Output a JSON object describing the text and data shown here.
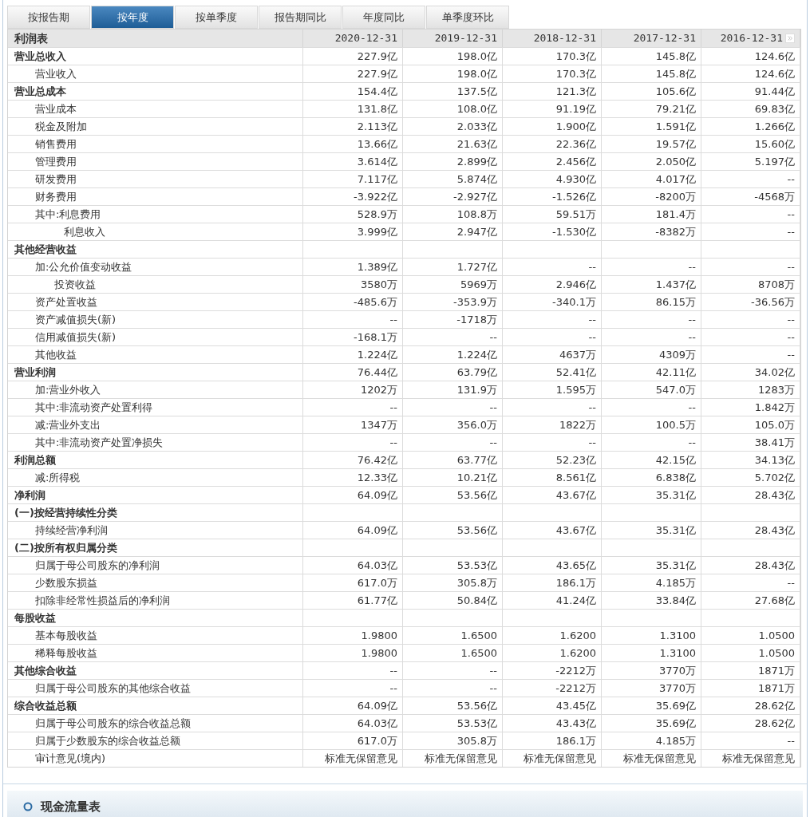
{
  "tabs": [
    {
      "label": "按报告期",
      "selected": false
    },
    {
      "label": "按年度",
      "selected": true
    },
    {
      "label": "按单季度",
      "selected": false
    },
    {
      "label": "报告期同比",
      "selected": false
    },
    {
      "label": "年度同比",
      "selected": false
    },
    {
      "label": "单季度环比",
      "selected": false
    }
  ],
  "table": {
    "title": "利润表",
    "columns": [
      "2020-12-31",
      "2019-12-31",
      "2018-12-31",
      "2017-12-31",
      "2016-12-31"
    ],
    "rows": [
      {
        "label": "营业总收入",
        "kind": "heading",
        "values": [
          "227.9亿",
          "198.0亿",
          "170.3亿",
          "145.8亿",
          "124.6亿"
        ]
      },
      {
        "label": "营业收入",
        "kind": "item",
        "values": [
          "227.9亿",
          "198.0亿",
          "170.3亿",
          "145.8亿",
          "124.6亿"
        ]
      },
      {
        "label": "营业总成本",
        "kind": "heading",
        "values": [
          "154.4亿",
          "137.5亿",
          "121.3亿",
          "105.6亿",
          "91.44亿"
        ]
      },
      {
        "label": "营业成本",
        "kind": "item",
        "values": [
          "131.8亿",
          "108.0亿",
          "91.19亿",
          "79.21亿",
          "69.83亿"
        ]
      },
      {
        "label": "税金及附加",
        "kind": "item",
        "values": [
          "2.113亿",
          "2.033亿",
          "1.900亿",
          "1.591亿",
          "1.266亿"
        ]
      },
      {
        "label": "销售费用",
        "kind": "item",
        "values": [
          "13.66亿",
          "21.63亿",
          "22.36亿",
          "19.57亿",
          "15.60亿"
        ]
      },
      {
        "label": "管理费用",
        "kind": "item",
        "values": [
          "3.614亿",
          "2.899亿",
          "2.456亿",
          "2.050亿",
          "5.197亿"
        ]
      },
      {
        "label": "研发费用",
        "kind": "item",
        "values": [
          "7.117亿",
          "5.874亿",
          "4.930亿",
          "4.017亿",
          "--"
        ]
      },
      {
        "label": "财务费用",
        "kind": "item",
        "values": [
          "-3.922亿",
          "-2.927亿",
          "-1.526亿",
          "-8200万",
          "-4568万"
        ]
      },
      {
        "label": "其中:利息费用",
        "kind": "item",
        "values": [
          "528.9万",
          "108.8万",
          "59.51万",
          "181.4万",
          "--"
        ]
      },
      {
        "label": "利息收入",
        "kind": "sub2",
        "values": [
          "3.999亿",
          "2.947亿",
          "-1.530亿",
          "-8382万",
          "--"
        ]
      },
      {
        "label": "其他经营收益",
        "kind": "heading"
      },
      {
        "label": "加:公允价值变动收益",
        "kind": "item",
        "values": [
          "1.389亿",
          "1.727亿",
          "--",
          "--",
          "--"
        ]
      },
      {
        "label": "投资收益",
        "kind": "sub",
        "values": [
          "3580万",
          "5969万",
          "2.946亿",
          "1.437亿",
          "8708万"
        ]
      },
      {
        "label": "资产处置收益",
        "kind": "item",
        "values": [
          "-485.6万",
          "-353.9万",
          "-340.1万",
          "86.15万",
          "-36.56万"
        ]
      },
      {
        "label": "资产减值损失(新)",
        "kind": "item",
        "values": [
          "--",
          "-1718万",
          "--",
          "--",
          "--"
        ]
      },
      {
        "label": "信用减值损失(新)",
        "kind": "item",
        "values": [
          "-168.1万",
          "--",
          "--",
          "--",
          "--"
        ]
      },
      {
        "label": "其他收益",
        "kind": "item",
        "values": [
          "1.224亿",
          "1.224亿",
          "4637万",
          "4309万",
          "--"
        ]
      },
      {
        "label": "营业利润",
        "kind": "heading",
        "values": [
          "76.44亿",
          "63.79亿",
          "52.41亿",
          "42.11亿",
          "34.02亿"
        ]
      },
      {
        "label": "加:营业外收入",
        "kind": "item",
        "values": [
          "1202万",
          "131.9万",
          "1.595万",
          "547.0万",
          "1283万"
        ]
      },
      {
        "label": "其中:非流动资产处置利得",
        "kind": "item",
        "values": [
          "--",
          "--",
          "--",
          "--",
          "1.842万"
        ]
      },
      {
        "label": "减:营业外支出",
        "kind": "item",
        "values": [
          "1347万",
          "356.0万",
          "1822万",
          "100.5万",
          "105.0万"
        ]
      },
      {
        "label": "其中:非流动资产处置净损失",
        "kind": "item",
        "values": [
          "--",
          "--",
          "--",
          "--",
          "38.41万"
        ]
      },
      {
        "label": "利润总额",
        "kind": "heading",
        "values": [
          "76.42亿",
          "63.77亿",
          "52.23亿",
          "42.15亿",
          "34.13亿"
        ]
      },
      {
        "label": "减:所得税",
        "kind": "item",
        "values": [
          "12.33亿",
          "10.21亿",
          "8.561亿",
          "6.838亿",
          "5.702亿"
        ]
      },
      {
        "label": "净利润",
        "kind": "heading",
        "values": [
          "64.09亿",
          "53.56亿",
          "43.67亿",
          "35.31亿",
          "28.43亿"
        ]
      },
      {
        "label": "(一)按经营持续性分类",
        "kind": "heading"
      },
      {
        "label": "持续经营净利润",
        "kind": "item",
        "values": [
          "64.09亿",
          "53.56亿",
          "43.67亿",
          "35.31亿",
          "28.43亿"
        ]
      },
      {
        "label": "(二)按所有权归属分类",
        "kind": "heading"
      },
      {
        "label": "归属于母公司股东的净利润",
        "kind": "item",
        "values": [
          "64.03亿",
          "53.53亿",
          "43.65亿",
          "35.31亿",
          "28.43亿"
        ]
      },
      {
        "label": "少数股东损益",
        "kind": "item",
        "values": [
          "617.0万",
          "305.8万",
          "186.1万",
          "4.185万",
          "--"
        ]
      },
      {
        "label": "扣除非经常性损益后的净利润",
        "kind": "item",
        "values": [
          "61.77亿",
          "50.84亿",
          "41.24亿",
          "33.84亿",
          "27.68亿"
        ]
      },
      {
        "label": "每股收益",
        "kind": "heading"
      },
      {
        "label": "基本每股收益",
        "kind": "item",
        "values": [
          "1.9800",
          "1.6500",
          "1.6200",
          "1.3100",
          "1.0500"
        ]
      },
      {
        "label": "稀释每股收益",
        "kind": "item",
        "values": [
          "1.9800",
          "1.6500",
          "1.6200",
          "1.3100",
          "1.0500"
        ]
      },
      {
        "label": "其他综合收益",
        "kind": "heading",
        "values": [
          "--",
          "--",
          "-2212万",
          "3770万",
          "1871万"
        ]
      },
      {
        "label": "归属于母公司股东的其他综合收益",
        "kind": "item",
        "values": [
          "--",
          "--",
          "-2212万",
          "3770万",
          "1871万"
        ]
      },
      {
        "label": "综合收益总额",
        "kind": "heading",
        "values": [
          "64.09亿",
          "53.56亿",
          "43.45亿",
          "35.69亿",
          "28.62亿"
        ]
      },
      {
        "label": "归属于母公司股东的综合收益总额",
        "kind": "item",
        "values": [
          "64.03亿",
          "53.53亿",
          "43.43亿",
          "35.69亿",
          "28.62亿"
        ]
      },
      {
        "label": "归属于少数股东的综合收益总额",
        "kind": "item",
        "values": [
          "617.0万",
          "305.8万",
          "186.1万",
          "4.185万",
          "--"
        ]
      },
      {
        "label": "审计意见(境内)",
        "kind": "item",
        "values": [
          "标准无保留意见",
          "标准无保留意见",
          "标准无保留意见",
          "标准无保留意见",
          "标准无保留意见"
        ]
      }
    ]
  },
  "section": {
    "title": "现金流量表"
  }
}
